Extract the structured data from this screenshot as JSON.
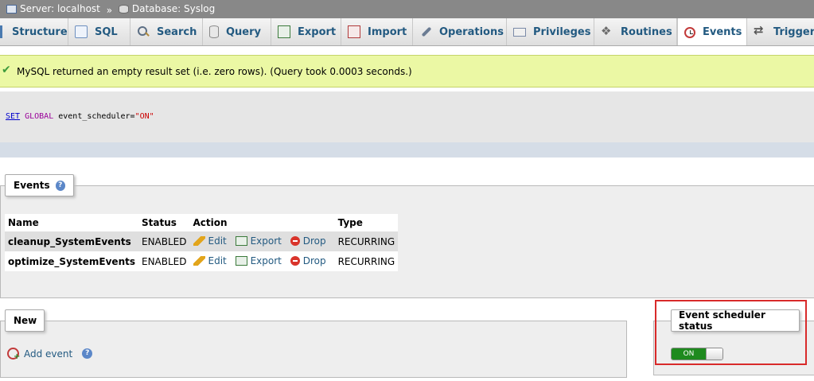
{
  "breadcrumb": {
    "server_label": "Server: localhost",
    "separator": "»",
    "database_label": "Database: Syslog"
  },
  "tabs": [
    {
      "label": "Structure",
      "icon": "structure-icon"
    },
    {
      "label": "SQL",
      "icon": "sql-icon"
    },
    {
      "label": "Search",
      "icon": "search-icon"
    },
    {
      "label": "Query",
      "icon": "query-icon"
    },
    {
      "label": "Export",
      "icon": "export-icon"
    },
    {
      "label": "Import",
      "icon": "import-icon"
    },
    {
      "label": "Operations",
      "icon": "operations-icon"
    },
    {
      "label": "Privileges",
      "icon": "privileges-icon"
    },
    {
      "label": "Routines",
      "icon": "routines-icon"
    },
    {
      "label": "Events",
      "icon": "events-icon",
      "active": true
    },
    {
      "label": "Trigger",
      "icon": "triggers-icon"
    }
  ],
  "message": {
    "text": "MySQL returned an empty result set (i.e. zero rows). (Query took 0.0003 seconds.)",
    "status_color": "#ebf8a4"
  },
  "sql": {
    "kw1": "SET",
    "kw2": "GLOBAL",
    "ident": " event_scheduler=",
    "value": "\"ON\""
  },
  "events_panel": {
    "legend": "Events",
    "help": "?",
    "columns": [
      "Name",
      "Status",
      "Action",
      "Type"
    ],
    "actions": {
      "edit": "Edit",
      "export": "Export",
      "drop": "Drop"
    },
    "rows": [
      {
        "name": "cleanup_SystemEvents",
        "status": "ENABLED",
        "type": "RECURRING"
      },
      {
        "name": "optimize_SystemEvents",
        "status": "ENABLED",
        "type": "RECURRING"
      }
    ]
  },
  "new_panel": {
    "legend": "New",
    "add_event": "Add event",
    "help": "?"
  },
  "scheduler_panel": {
    "legend": "Event scheduler status",
    "toggle_label": "ON",
    "toggle_state": "on",
    "toggle_color": "#1e8a1e",
    "highlight_color": "#d82a2a"
  },
  "colors": {
    "link": "#235a81",
    "topbar": "#888888"
  }
}
